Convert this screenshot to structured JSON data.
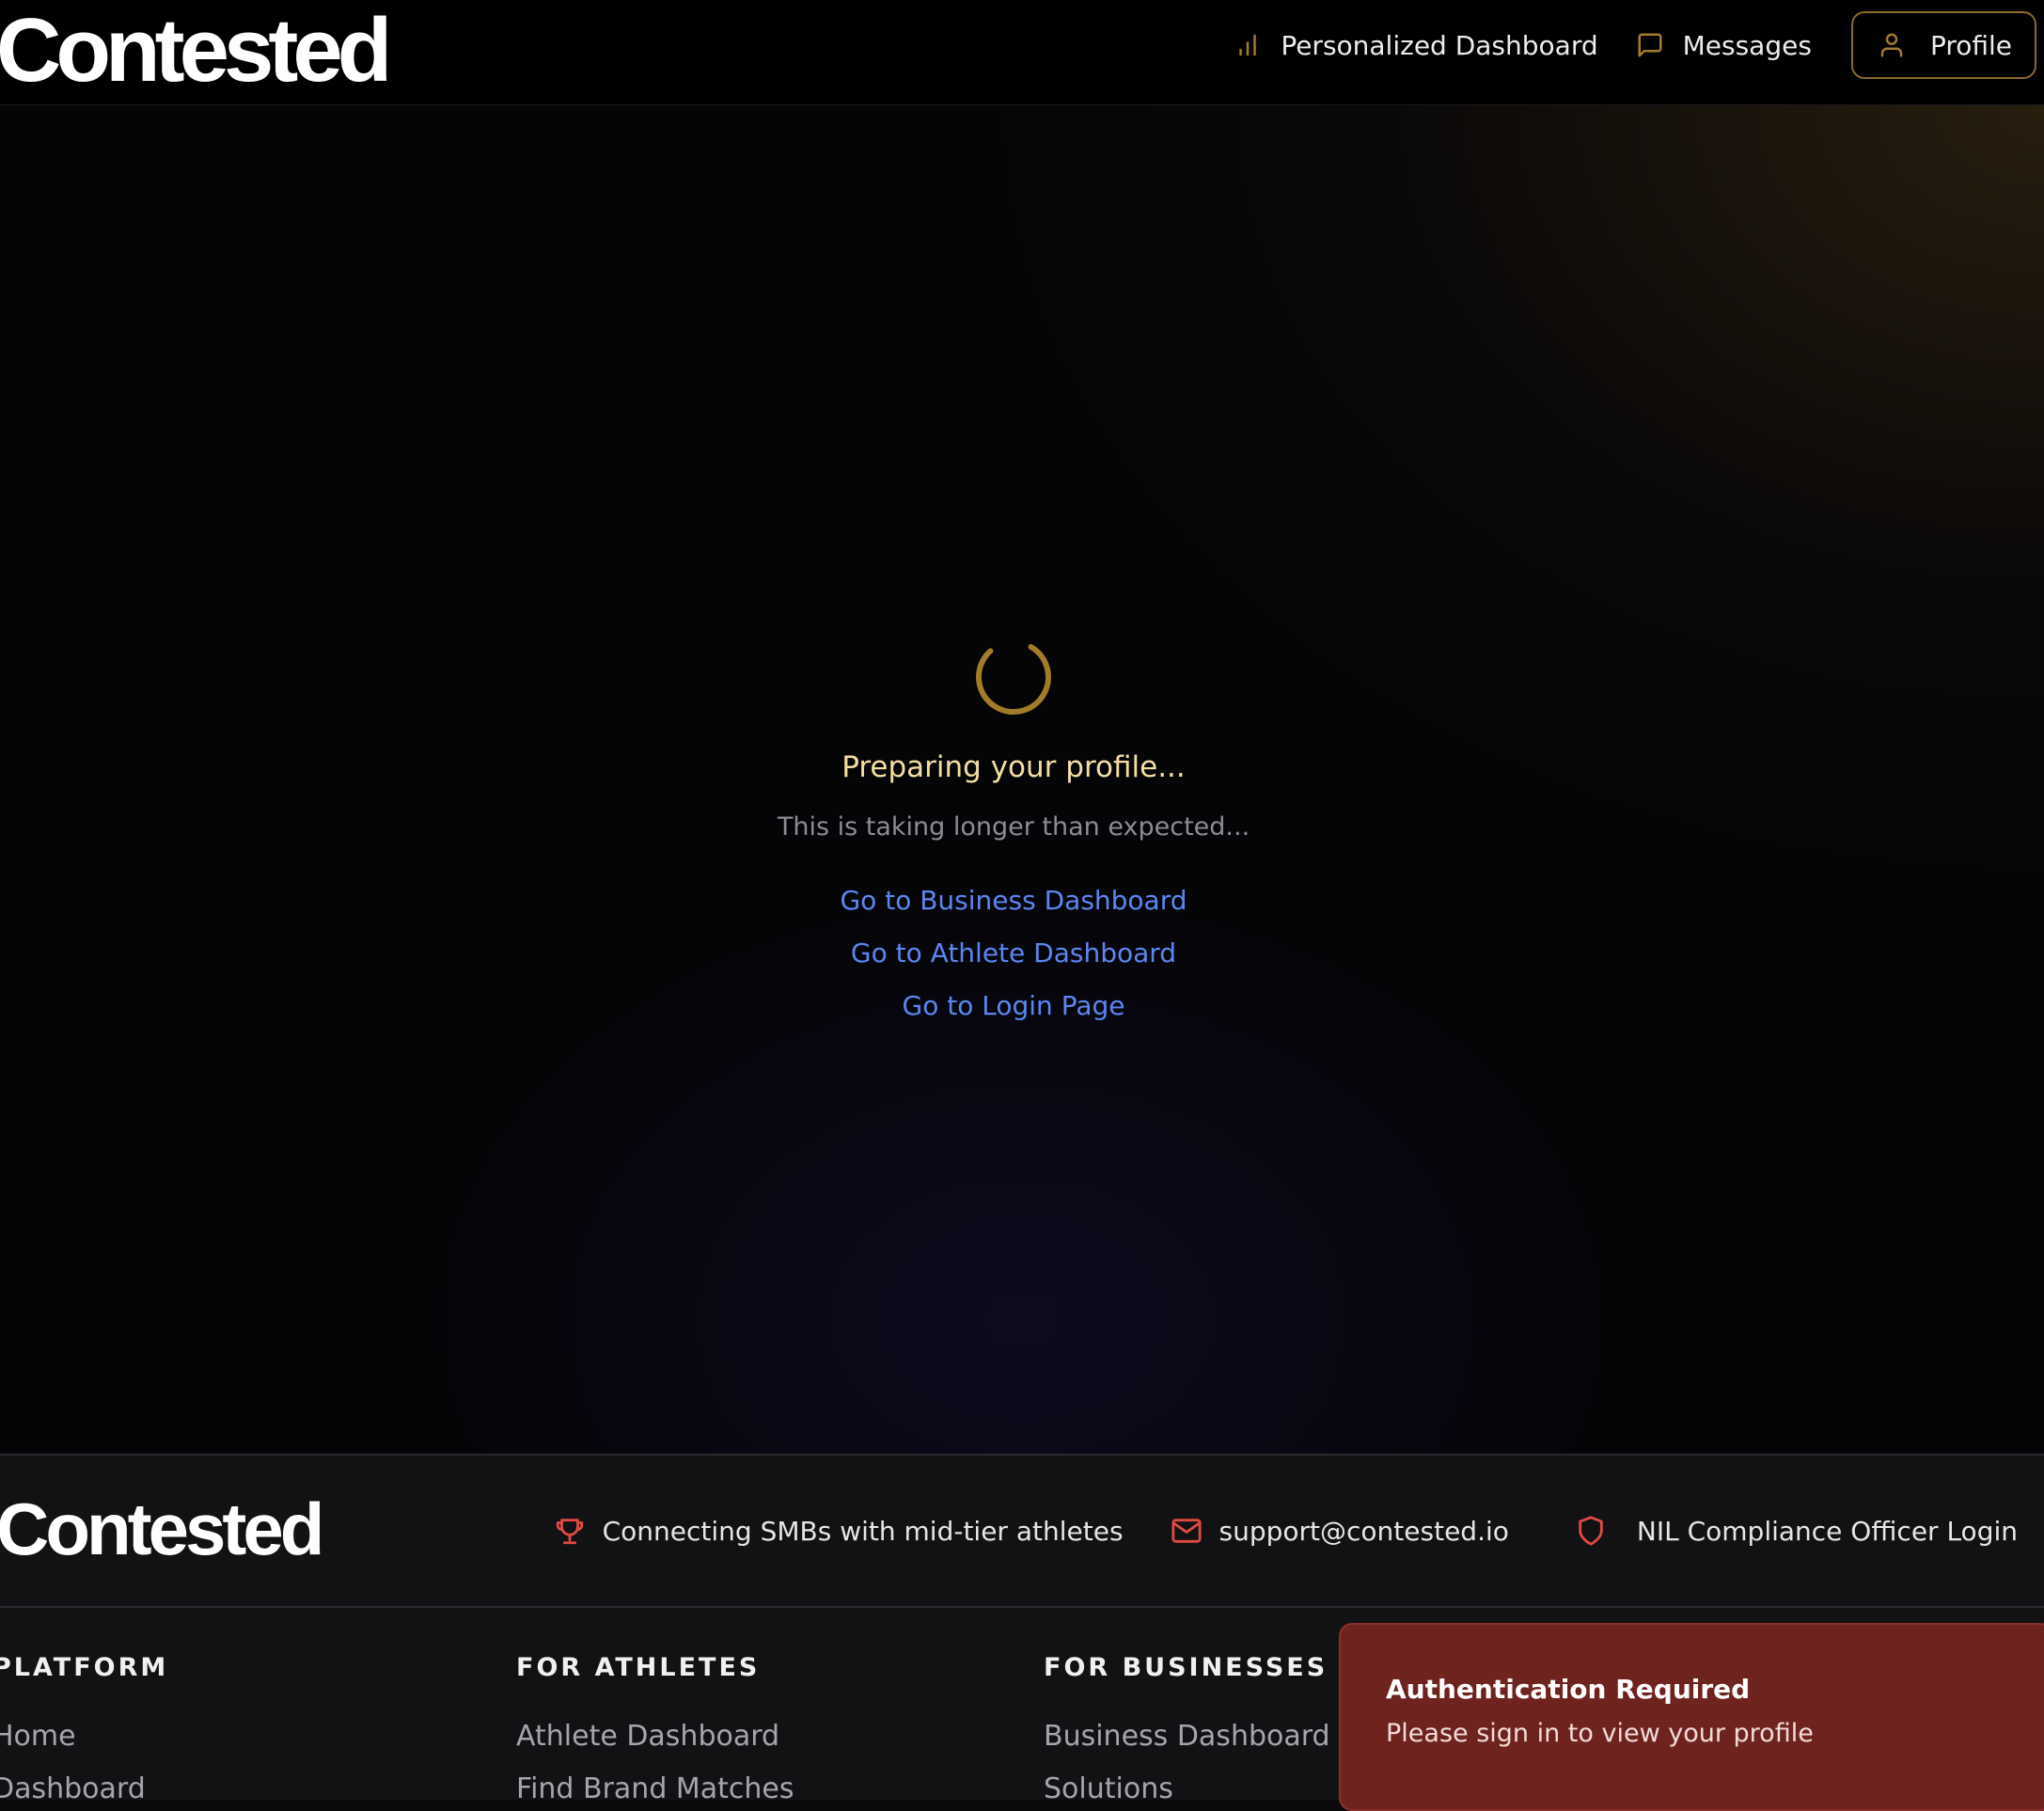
{
  "brand": {
    "logo_text": "Contested"
  },
  "header": {
    "nav": [
      {
        "label": "Personalized Dashboard",
        "icon": "bar-chart-icon"
      },
      {
        "label": "Messages",
        "icon": "message-square-icon"
      },
      {
        "label": "Profile",
        "icon": "user-icon"
      }
    ]
  },
  "main": {
    "loading_title": "Preparing your profile...",
    "loading_subtitle": "This is taking longer than expected...",
    "links": [
      {
        "label": "Go to Business Dashboard"
      },
      {
        "label": "Go to Athlete Dashboard"
      },
      {
        "label": "Go to Login Page"
      }
    ]
  },
  "footer": {
    "logo_text": "Contested",
    "info": [
      {
        "label": "Connecting SMBs with mid-tier athletes",
        "icon": "trophy-icon"
      },
      {
        "label": "support@contested.io",
        "icon": "mail-icon"
      },
      {
        "label": "NIL Compliance Officer Login",
        "icon": "shield-icon"
      }
    ],
    "columns": [
      {
        "title": "PLATFORM",
        "items": [
          "Home",
          "Dashboard"
        ]
      },
      {
        "title": "FOR ATHLETES",
        "items": [
          "Athlete Dashboard",
          "Find Brand Matches"
        ]
      },
      {
        "title": "FOR BUSINESSES",
        "items": [
          "Business Dashboard",
          "Solutions"
        ]
      }
    ]
  },
  "toast": {
    "title": "Authentication Required",
    "message": "Please sign in to view your profile"
  },
  "colors": {
    "accent_gold": "#a37c2a",
    "link_blue": "#5b86f2",
    "toast_red": "#6f231f",
    "icon_red": "#e04a43"
  }
}
